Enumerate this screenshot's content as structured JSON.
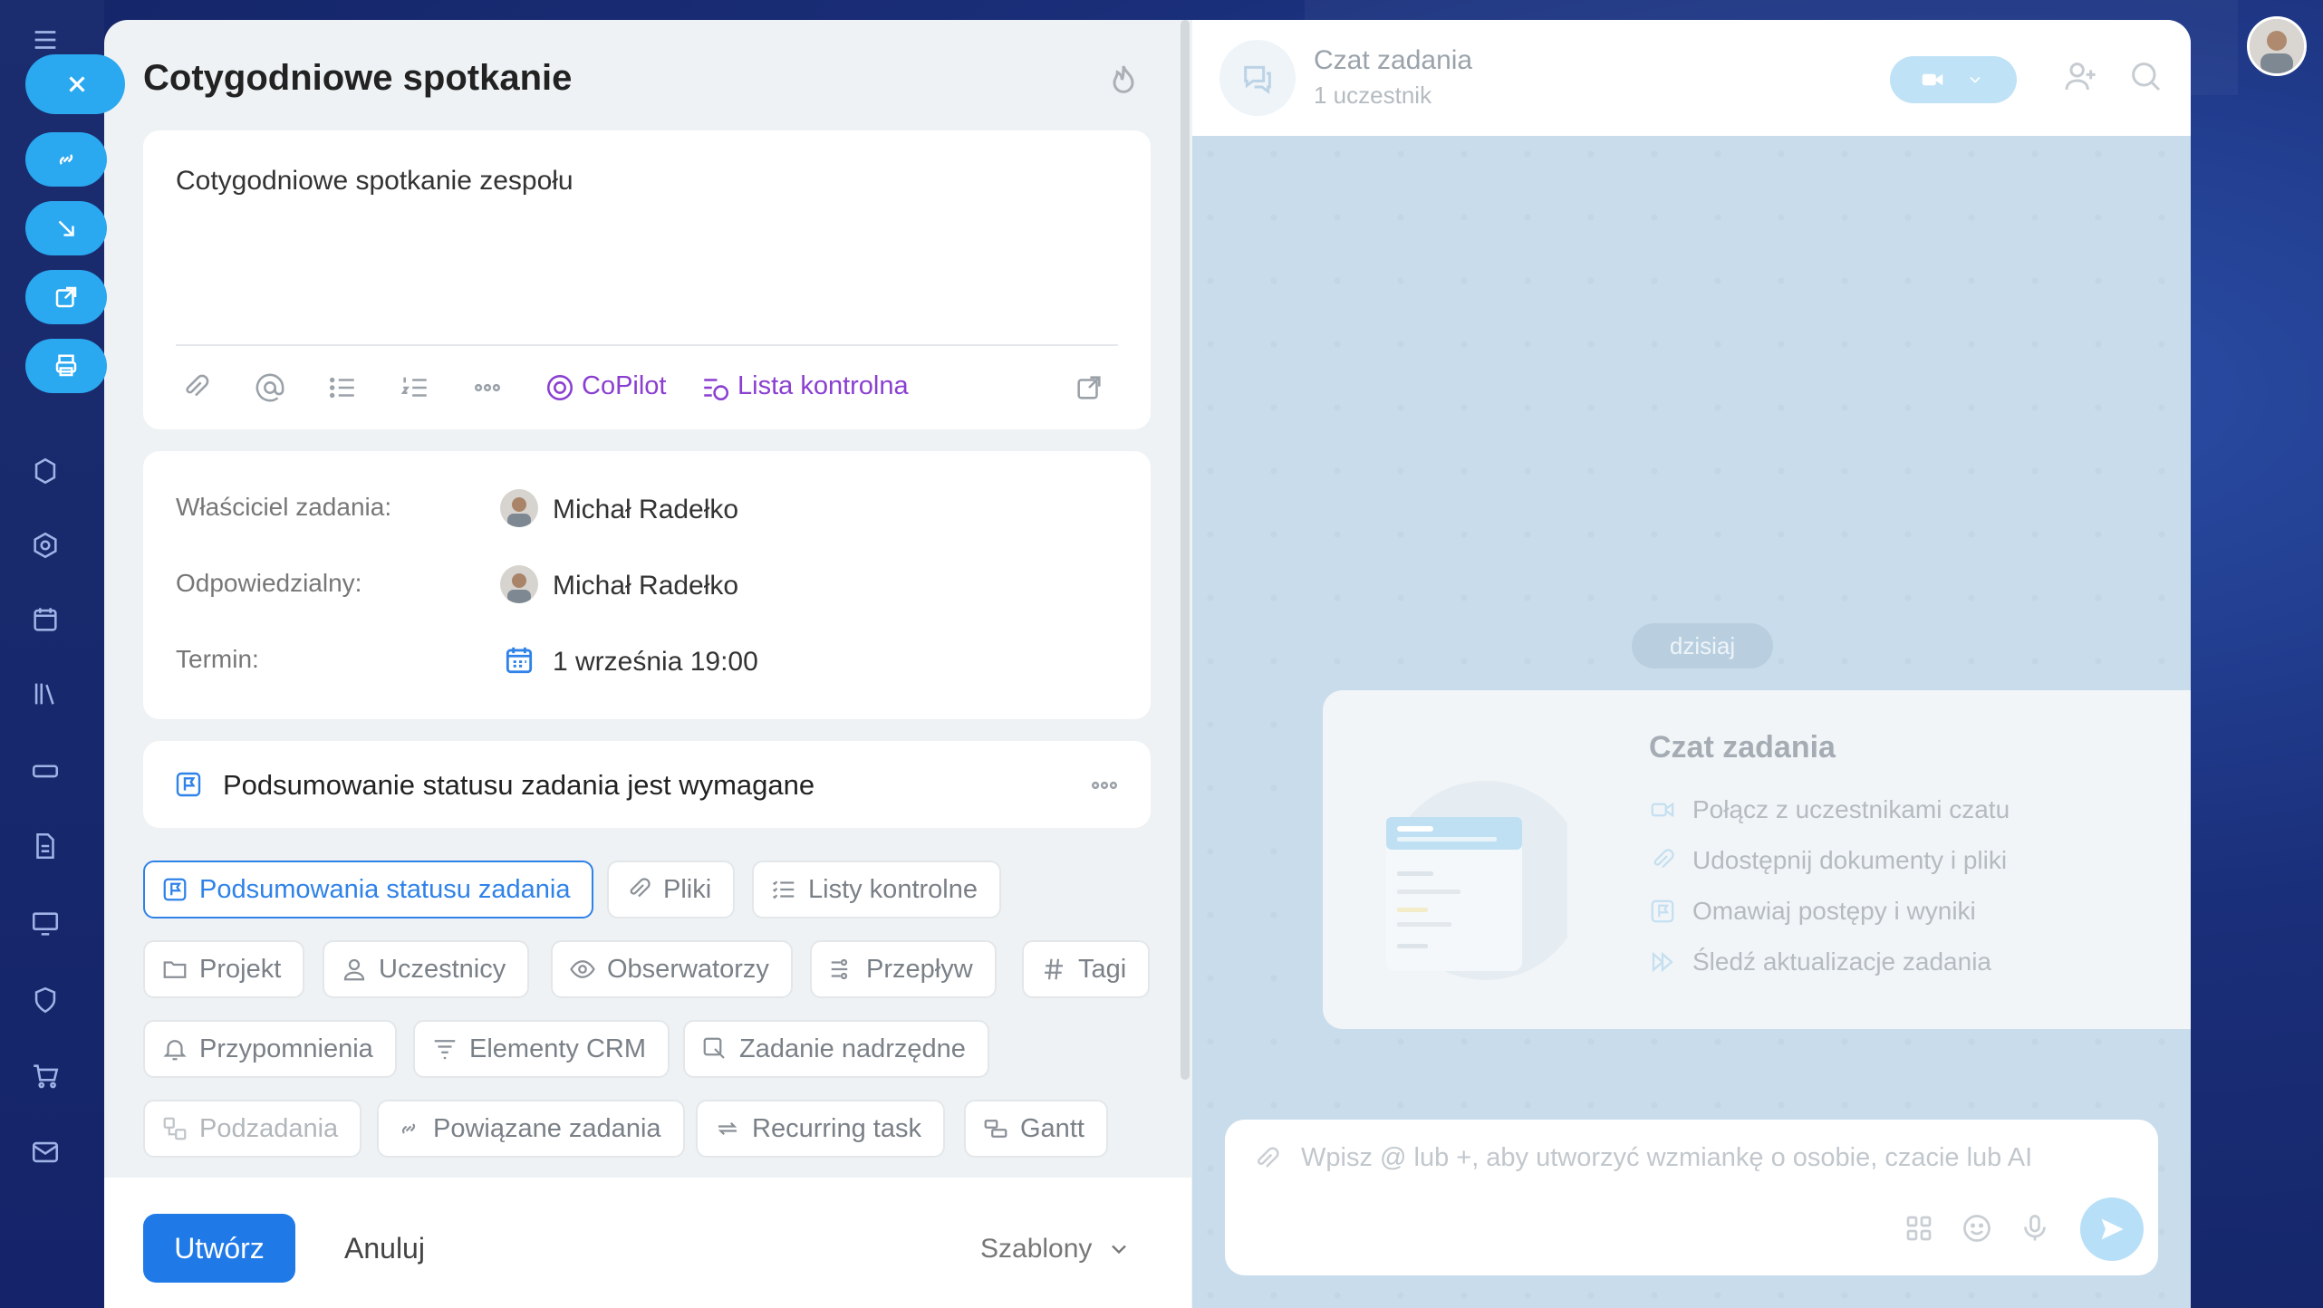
{
  "task": {
    "title": "Cotygodniowe spotkanie",
    "description": "Cotygodniowe spotkanie zespołu",
    "toolbar": {
      "copilot_label": "CoPilot",
      "checklist_label": "Lista kontrolna"
    },
    "fields": {
      "owner_label": "Właściciel zadania:",
      "owner_value": "Michał Radełko",
      "responsible_label": "Odpowiedzialny:",
      "responsible_value": "Michał Radełko",
      "deadline_label": "Termin:",
      "deadline_value": "1 września 19:00"
    },
    "status_summary_text": "Podsumowanie statusu zadania jest wymagane",
    "chips": {
      "status_summaries": "Podsumowania statusu zadania",
      "files": "Pliki",
      "checklists": "Listy kontrolne",
      "project": "Projekt",
      "participants": "Uczestnicy",
      "observers": "Obserwatorzy",
      "flow": "Przepływ",
      "tags": "Tagi",
      "reminders": "Przypomnienia",
      "crm": "Elementy CRM",
      "parent_task": "Zadanie nadrzędne",
      "subtasks": "Podzadania",
      "related_tasks": "Powiązane zadania",
      "recurring": "Recurring task",
      "gantt": "Gantt"
    },
    "footer": {
      "create_label": "Utwórz",
      "cancel_label": "Anuluj",
      "templates_label": "Szablony"
    }
  },
  "chat": {
    "title": "Czat zadania",
    "subtitle": "1 uczestnik",
    "date_pill": "dzisiaj",
    "welcome_title": "Czat zadania",
    "welcome_items": [
      "Połącz z uczestnikami czatu",
      "Udostępnij dokumenty i pliki",
      "Omawiaj postępy i wyniki",
      "Śledź aktualizacje zadania"
    ],
    "composer_placeholder": "Wpisz @ lub +, aby utworzyć wzmiankę o osobie, czacie lub AI"
  },
  "colors": {
    "primary": "#1f7ae8",
    "copilot": "#8a3fd1",
    "side_button": "#2aa8f0"
  }
}
